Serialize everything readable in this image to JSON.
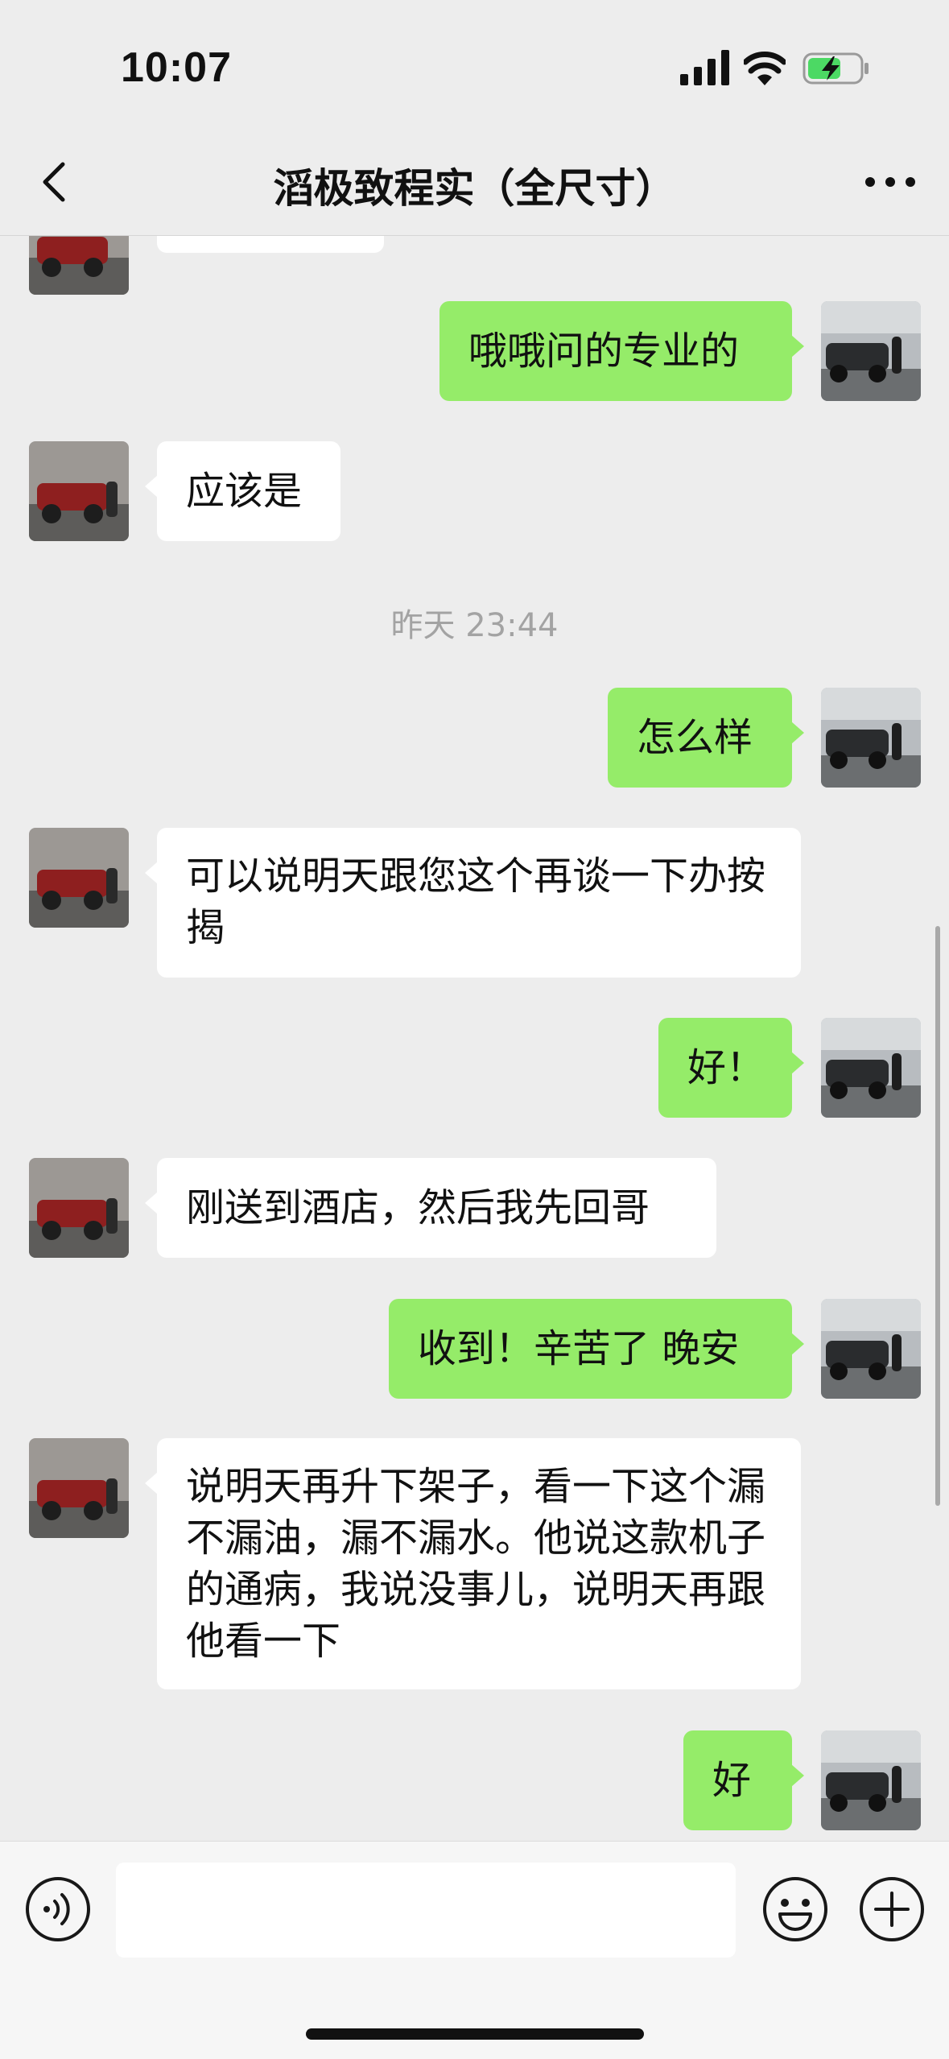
{
  "status_bar": {
    "time": "10:07"
  },
  "nav": {
    "title": "滔极致程实（全尺寸）"
  },
  "messages": [
    {
      "text": "哦哦问的专业的"
    },
    {
      "text": "应该是"
    },
    {
      "timestamp": "昨天 23:44"
    },
    {
      "text": "怎么样"
    },
    {
      "text": "可以说明天跟您这个再谈一下办按揭"
    },
    {
      "text": "好！"
    },
    {
      "text": "刚送到酒店，然后我先回哥"
    },
    {
      "text": "收到！辛苦了 晚安"
    },
    {
      "text": "说明天再升下架子，看一下这个漏不漏油，漏不漏水。他说这款机子的通病，我说没事儿，说明天再跟他看一下"
    },
    {
      "text": "好"
    }
  ],
  "colors": {
    "outgoing_bubble": "#95ec69",
    "incoming_bubble": "#ffffff",
    "background": "#ededed"
  },
  "icons": [
    "back-icon",
    "more-icon",
    "voice-icon",
    "emoji-icon",
    "plus-icon"
  ]
}
